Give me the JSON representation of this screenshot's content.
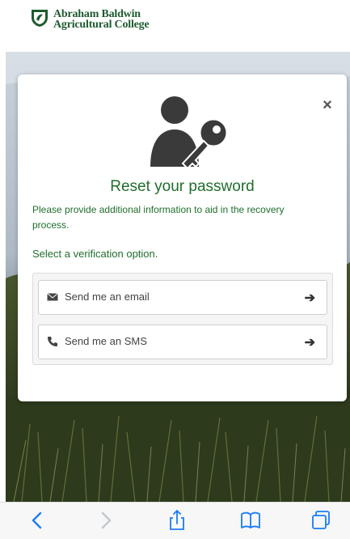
{
  "header": {
    "logo_line1": "Abraham Baldwin",
    "logo_line2": "Agricultural College",
    "logo_icon": "abac-shield-icon"
  },
  "dialog": {
    "close_label": "×",
    "hero_icon": "user-key-icon",
    "title": "Reset your password",
    "description": "Please provide additional information to aid in the recovery process.",
    "select_label": "Select a verification option.",
    "options": [
      {
        "icon": "envelope-icon",
        "label": "Send me an email",
        "arrow": "➔"
      },
      {
        "icon": "phone-icon",
        "label": "Send me an SMS",
        "arrow": "➔"
      }
    ]
  },
  "browser_toolbar": {
    "items": [
      "back-icon",
      "forward-icon",
      "share-icon",
      "bookmarks-icon",
      "tabs-icon"
    ]
  },
  "colors": {
    "brand_green": "#1f6e2c",
    "toolbar_blue": "#1a7cf5"
  }
}
